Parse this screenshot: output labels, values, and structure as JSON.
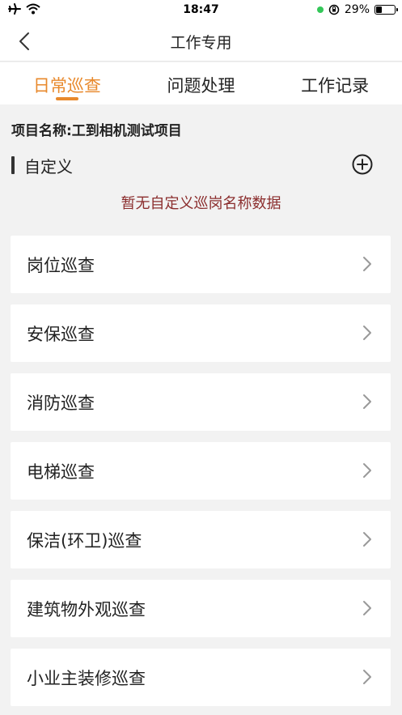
{
  "status_bar": {
    "time": "18:47",
    "battery_text": "29%",
    "battery_level": 0.29,
    "icons": [
      "airplane-icon",
      "wifi-icon",
      "location-dot-icon",
      "orientation-lock-icon",
      "battery-icon"
    ]
  },
  "nav": {
    "title": "工作专用",
    "back_icon": "chevron-left-icon"
  },
  "tabs": [
    {
      "label": "日常巡查",
      "active": true
    },
    {
      "label": "问题处理",
      "active": false
    },
    {
      "label": "工作记录",
      "active": false
    }
  ],
  "project": {
    "name": "项目名称:工到相机测试项目"
  },
  "custom": {
    "label": "自定义",
    "add_icon": "plus-circle-icon",
    "empty_message": "暂无自定义巡岗名称数据"
  },
  "patrol_items": [
    {
      "label": "岗位巡查"
    },
    {
      "label": "安保巡查"
    },
    {
      "label": "消防巡查"
    },
    {
      "label": "电梯巡查"
    },
    {
      "label": "保洁(环卫)巡查"
    },
    {
      "label": "建筑物外观巡查"
    },
    {
      "label": "小业主装修巡查"
    }
  ],
  "colors": {
    "accent": "#e8892c",
    "empty_text": "#8b2d2d",
    "background": "#f2f2f2"
  }
}
